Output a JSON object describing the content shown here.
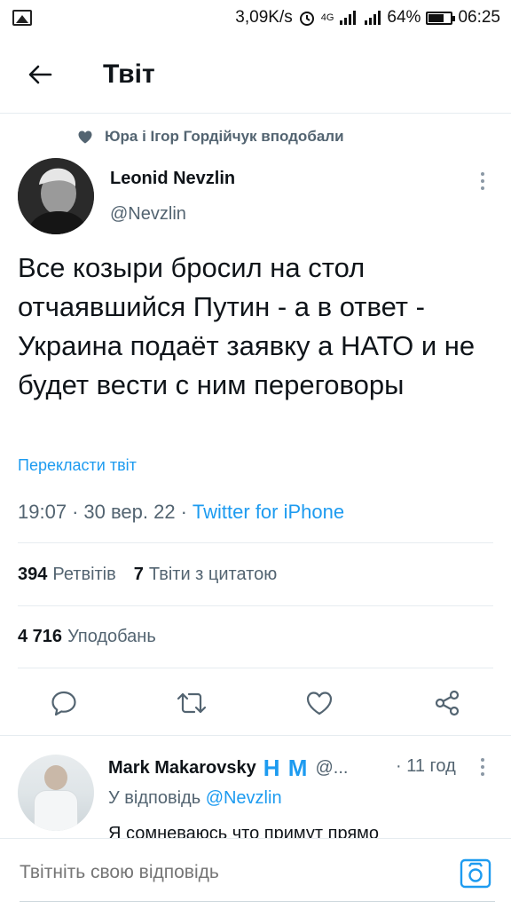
{
  "status_bar": {
    "speed": "3,09K/s",
    "network": "4G",
    "battery": "64%",
    "battery_level": 0.64,
    "time": "06:25"
  },
  "header": {
    "title": "Твіт"
  },
  "tweet": {
    "liked_by": "Юра і Ігор Гордійчук вподобали",
    "author_name": "Leonid Nevzlin",
    "author_handle": "@Nevzlin",
    "text": "Все козыри бросил на стол отчаявшийся Путин - а в ответ - Украина подаёт заявку а НАТО и не будет вести с ним переговоры",
    "translate": "Перекласти твіт",
    "time": "19:07",
    "dot1": "·",
    "date": "30 вер. 22",
    "dot2": "·",
    "source": "Twitter for iPhone",
    "retweets_count": "394",
    "retweets_label": "Ретвітів",
    "quotes_count": "7",
    "quotes_label": "Твіти з цитатою",
    "likes_count": "4 716",
    "likes_label": "Уподобань"
  },
  "reply": {
    "name": "Mark Makarovsky",
    "badge": "Н М",
    "handle": "@...",
    "time": "· 11 год",
    "replying_to_label": "У відповідь",
    "replying_to_handle": "@Nevzlin",
    "text": "Я сомневаюсь что примут прямо"
  },
  "composer": {
    "placeholder": "Твітніть свою відповідь"
  },
  "colors": {
    "accent": "#1d9bf0",
    "secondary_text": "#536471",
    "primary_text": "#0f1419"
  }
}
